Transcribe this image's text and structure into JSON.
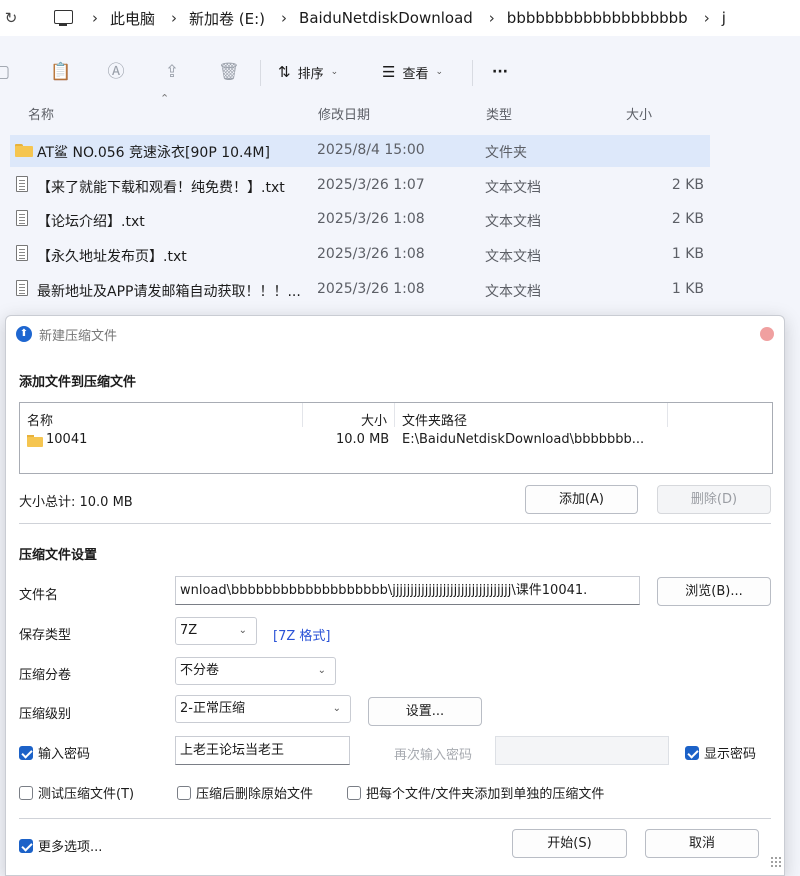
{
  "explorer": {
    "breadcrumbs": [
      "此电脑",
      "新加卷 (E:)",
      "BaiduNetdiskDownload",
      "bbbbbbbbbbbbbbbbbbb",
      "j"
    ],
    "toolbar": {
      "sort_label": "排序",
      "view_label": "查看",
      "more_label": "···"
    },
    "columns": {
      "name": "名称",
      "date": "修改日期",
      "type": "类型",
      "size": "大小"
    },
    "files": [
      {
        "name": "AT鲨 NO.056 竞速泳衣[90P 10.4M]",
        "date": "2025/8/4 15:00",
        "type": "文件夹",
        "size": "",
        "kind": "folder",
        "selected": true
      },
      {
        "name": "【来了就能下载和观看！纯免费！】.txt",
        "date": "2025/3/26 1:07",
        "type": "文本文档",
        "size": "2 KB",
        "kind": "doc",
        "selected": false
      },
      {
        "name": "【论坛介绍】.txt",
        "date": "2025/3/26 1:08",
        "type": "文本文档",
        "size": "2 KB",
        "kind": "doc",
        "selected": false
      },
      {
        "name": "【永久地址发布页】.txt",
        "date": "2025/3/26 1:08",
        "type": "文本文档",
        "size": "1 KB",
        "kind": "doc",
        "selected": false
      },
      {
        "name": "最新地址及APP请发邮箱自动获取！！！...",
        "date": "2025/3/26 1:08",
        "type": "文本文档",
        "size": "1 KB",
        "kind": "doc",
        "selected": false
      }
    ]
  },
  "dialog": {
    "title": "新建压缩文件",
    "add_section_title": "添加文件到压缩文件",
    "list_columns": {
      "name": "名称",
      "size": "大小",
      "path": "文件夹路径"
    },
    "list_items": [
      {
        "name": "10041",
        "size": "10.0 MB",
        "path": "E:\\BaiduNetdiskDownload\\bbbbbbb..."
      }
    ],
    "total_size": "大小总计: 10.0 MB",
    "add_button": "添加(A)",
    "delete_button": "删除(D)",
    "settings_section_title": "压缩文件设置",
    "filename_label": "文件名",
    "filename_value": "wnload\\bbbbbbbbbbbbbbbbbbb\\jjjjjjjjjjjjjjjjjjjjjjjjjjjjjjjjj\\课件10041.",
    "browse_button": "浏览(B)...",
    "save_type_label": "保存类型",
    "save_type_value": "7Z",
    "format_link": "[7Z 格式]",
    "split_label": "压缩分卷",
    "split_value": "不分卷",
    "level_label": "压缩级别",
    "level_value": "2-正常压缩",
    "settings_button": "设置...",
    "password_checkbox": "输入密码",
    "password_checked": true,
    "password_value": "上老王论坛当老王",
    "reenter_label": "再次输入密码",
    "show_password_checkbox": "显示密码",
    "show_password_checked": true,
    "test_checkbox": "测试压缩文件(T)",
    "delete_after_checkbox": "压缩后删除原始文件",
    "separate_checkbox": "把每个文件/文件夹添加到单独的压缩文件",
    "more_options_checkbox": "更多选项...",
    "more_options_checked": true,
    "start_button": "开始(S)",
    "cancel_button": "取消"
  }
}
